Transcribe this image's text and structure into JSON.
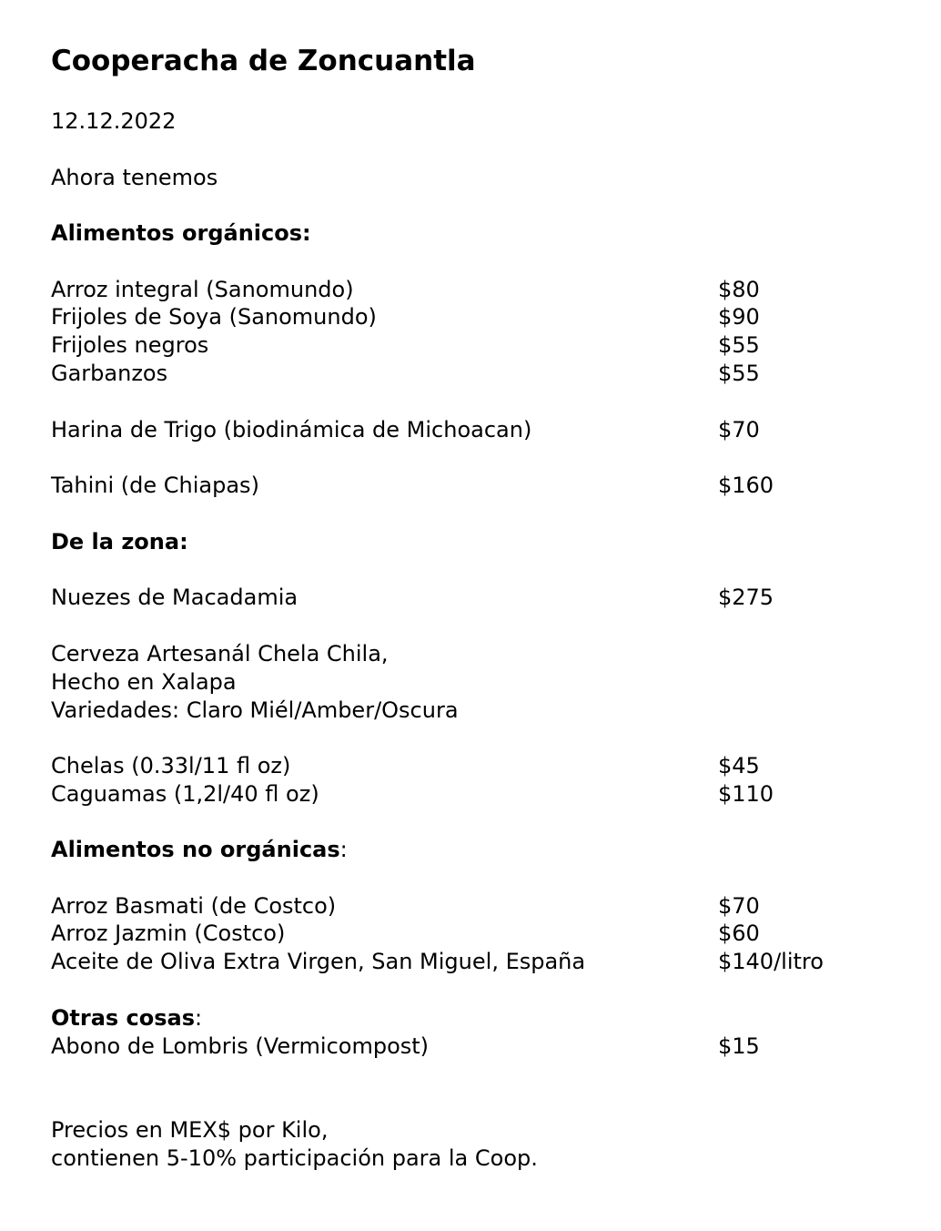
{
  "title": "Cooperacha de Zoncuantla",
  "date": "12.12.2022",
  "intro": "Ahora tenemos",
  "organicos": {
    "heading": "Alimentos orgánicos:",
    "items": [
      {
        "name": "Arroz integral (Sanomundo)",
        "price": "$80"
      },
      {
        "name": "Frijoles de Soya (Sanomundo)",
        "price": "$90"
      },
      {
        "name": "Frijoles negros",
        "price": "$55"
      },
      {
        "name": "Garbanzos",
        "price": "$55"
      },
      {
        "name": "Harina de Trigo (biodinámica de Michoacan)",
        "price": "$70"
      },
      {
        "name": "Tahini (de Chiapas)",
        "price": "$160"
      }
    ]
  },
  "zona": {
    "heading": "De la zona:",
    "items": [
      {
        "name": "Nuezes de Macadamia",
        "price": "$275"
      }
    ],
    "cerveza_lines": [
      "Cerveza Artesanál Chela Chila,",
      "Hecho en Xalapa",
      "Variedades: Claro Miél/Amber/Oscura"
    ],
    "cerveza_items": [
      {
        "name": "Chelas (0.33l/11 fl oz)",
        "price": "$45"
      },
      {
        "name": "Caguamas (1,2l/40 fl oz)",
        "price": "$110"
      }
    ]
  },
  "no_organicas": {
    "heading": "Alimentos no orgánicas",
    "heading_suffix": ":",
    "items": [
      {
        "name": "Arroz Basmati (de Costco)",
        "price": "$70"
      },
      {
        "name": "Arroz Jazmin (Costco)",
        "price": "$60"
      },
      {
        "name": "Aceite de Oliva Extra Virgen, San Miguel, España",
        "price": "$140/litro"
      }
    ]
  },
  "otras": {
    "heading": "Otras cosas",
    "heading_suffix": ":",
    "items": [
      {
        "name": "Abono de Lombris (Vermicompost)",
        "price": "$15"
      }
    ]
  },
  "footer": [
    "Precios en MEX$ por Kilo,",
    "contienen 5-10% participación para la Coop."
  ]
}
